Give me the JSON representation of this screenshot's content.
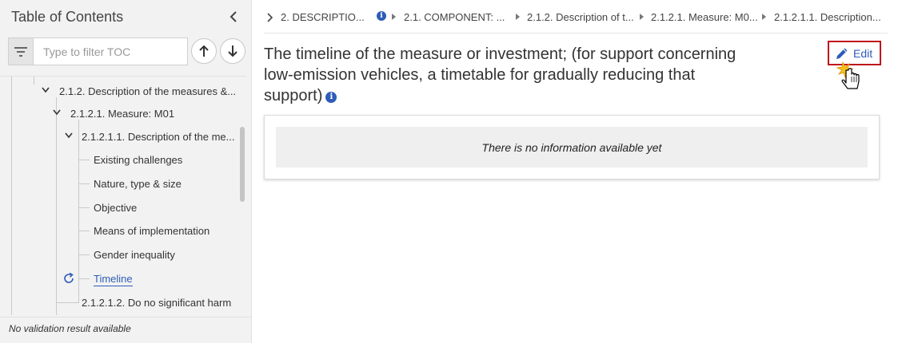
{
  "sidebar": {
    "title": "Table of Contents",
    "filter_placeholder": "Type to filter TOC",
    "tree": {
      "item_212": "2.1.2. Description of the measures &...",
      "item_2121": "2.1.2.1. Measure: M01",
      "item_21211": "2.1.2.1.1. Description of the me...",
      "children": [
        "Existing challenges",
        "Nature, type & size",
        "Objective",
        "Means of implementation",
        "Gender inequality"
      ],
      "active": "Timeline",
      "item_21212": "2.1.2.1.2. Do no significant harm"
    },
    "validation": "No validation result available"
  },
  "breadcrumb": {
    "items": [
      "2. DESCRIPTIO...",
      "2.1. COMPONENT: ...",
      "2.1.2. Description of t...",
      "2.1.2.1. Measure: M0...",
      "2.1.2.1.1. Description..."
    ],
    "info_icon": "i"
  },
  "main": {
    "title": "The timeline of the measure or investment; (for support concerning low-emission vehicles, a timetable for gradually reducing that support)",
    "info_icon": "i",
    "edit_label": "Edit",
    "empty_message": "There is no information available yet"
  },
  "colors": {
    "accent": "#2e5cb8",
    "highlight_border": "#c0141c"
  }
}
